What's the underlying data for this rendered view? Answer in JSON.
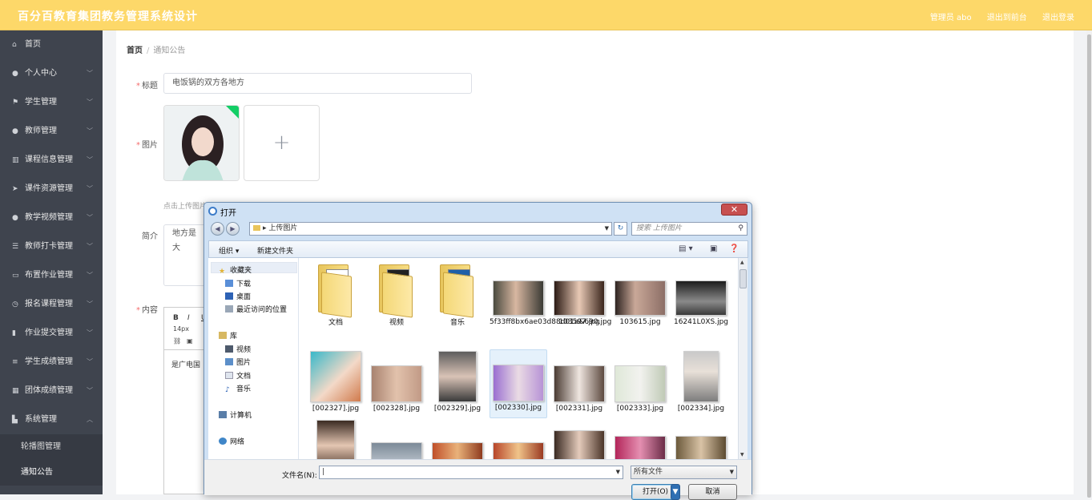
{
  "app": {
    "title": "百分百教育集团教务管理系统设计",
    "user_label": "管理员 abo",
    "back_to_front": "退出到前台",
    "logout": "退出登录"
  },
  "sidebar": {
    "items": [
      {
        "label": "首页",
        "icon": "home-icon"
      },
      {
        "label": "个人中心",
        "icon": "user-icon"
      },
      {
        "label": "学生管理",
        "icon": "flag-icon"
      },
      {
        "label": "教师管理",
        "icon": "user-icon"
      },
      {
        "label": "课程信息管理",
        "icon": "bar-chart-icon"
      },
      {
        "label": "课件资源管理",
        "icon": "send-icon"
      },
      {
        "label": "教学视频管理",
        "icon": "user-icon"
      },
      {
        "label": "教师打卡管理",
        "icon": "sliders-icon"
      },
      {
        "label": "布置作业管理",
        "icon": "chat-icon"
      },
      {
        "label": "报名课程管理",
        "icon": "clock-icon"
      },
      {
        "label": "作业提交管理",
        "icon": "trash-icon"
      },
      {
        "label": "学生成绩管理",
        "icon": "list-icon"
      },
      {
        "label": "团体成绩管理",
        "icon": "grid-icon"
      },
      {
        "label": "系统管理",
        "icon": "stats-icon"
      }
    ],
    "subitems": [
      {
        "label": "轮播图管理"
      },
      {
        "label": "通知公告"
      }
    ]
  },
  "breadcrumb": {
    "home": "首页",
    "current": "通知公告"
  },
  "form": {
    "title_label": "标题",
    "title_value": "电饭锅的双方各地方",
    "image_label": "图片",
    "upload_tip": "点击上传图片",
    "intro_label": "简介",
    "intro_value": "地方是大",
    "content_label": "内容",
    "editor_size": "14px",
    "editor_text": "是广电国",
    "editor_tools": [
      "B",
      "I",
      "U"
    ]
  },
  "dialog": {
    "title": "打开",
    "close": "✕",
    "address": "上传图片",
    "search_placeholder": "搜索 上传图片",
    "organize": "组织 ▾",
    "new_folder": "新建文件夹",
    "tree": {
      "favorites": "收藏夹",
      "downloads": "下载",
      "desktop": "桌面",
      "recent": "最近访问的位置",
      "library": "库",
      "videos": "视频",
      "pictures": "图片",
      "documents": "文档",
      "music": "音乐",
      "computer": "计算机",
      "network": "网络"
    },
    "files": [
      {
        "name": "文档"
      },
      {
        "name": "视频"
      },
      {
        "name": "音乐"
      },
      {
        "name": "5f33ff8bx6ae03d88d01a&690.jpg"
      },
      {
        "name": "103597.jpg"
      },
      {
        "name": "103615.jpg"
      },
      {
        "name": "16241L0XS.jpg"
      },
      {
        "name": "[002327].jpg"
      },
      {
        "name": "[002328].jpg"
      },
      {
        "name": "[002329].jpg"
      },
      {
        "name": "[002330].jpg"
      },
      {
        "name": "[002331].jpg"
      },
      {
        "name": "[002333].jpg"
      },
      {
        "name": "[002334].jpg"
      }
    ],
    "filename_label": "文件名(N):",
    "filename_value": "",
    "filetype": "所有文件",
    "open_button": "打开(O)",
    "cancel_button": "取消"
  }
}
